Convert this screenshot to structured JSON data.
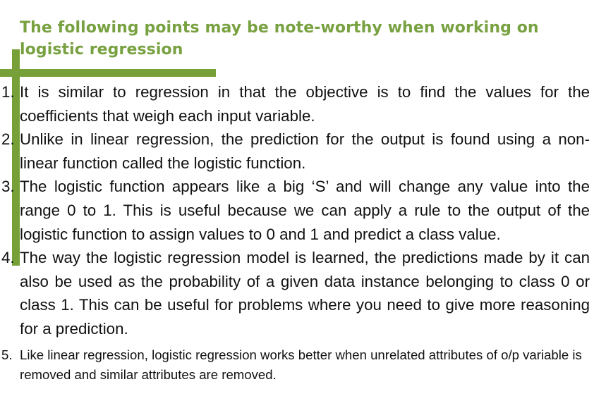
{
  "slide": {
    "title": "The following points may be note-worthy when working on logistic regression",
    "accent_color": "#77a138",
    "title_color": "#78a141",
    "points": [
      {
        "number": "1.",
        "text": "It is similar to regression in that the objective is to find the values for the coefficients that weigh each input variable."
      },
      {
        "number": "2.",
        "text": "Unlike in linear regression, the prediction for the output is found using a non-linear function called the logistic function."
      },
      {
        "number": "3.",
        "text": "The logistic function appears like a big ‘S’ and will change any value into the range 0 to 1. This is useful because we can apply a rule to the output of the logistic function to assign values to 0 and 1 and predict a class value."
      },
      {
        "number": "4.",
        "text": "The way the logistic regression model is learned, the predictions made by it can also be used as the probability of a given data instance belonging to class 0 or class 1. This can be useful for problems where you need to give more reasoning for a prediction."
      },
      {
        "number": "5.",
        "text": "Like linear regression, logistic regression works better when unrelated attributes of o/p variable is removed and similar attributes are removed."
      }
    ]
  }
}
